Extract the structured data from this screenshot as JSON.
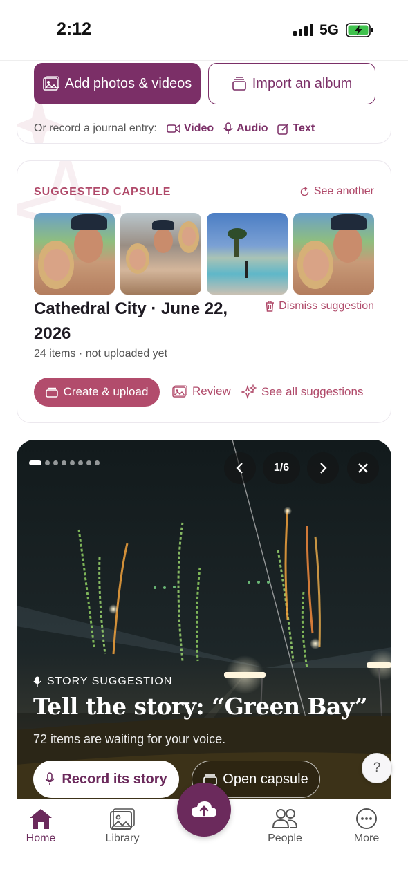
{
  "status_bar": {
    "time": "2:12",
    "network": "5G"
  },
  "top_card": {
    "add_label": "Add photos & videos",
    "import_label": "Import an album",
    "journal_prompt": "Or record a journal entry:",
    "journal_options": {
      "video": "Video",
      "audio": "Audio",
      "text": "Text"
    }
  },
  "suggested_capsule": {
    "section_label": "SUGGESTED CAPSULE",
    "see_another": "See another",
    "title": "Cathedral City · June 22, 2026",
    "dismiss": "Dismiss suggestion",
    "subtitle": "24 items · not uploaded yet",
    "create_label": "Create & upload",
    "review_label": "Review",
    "see_all_label": "See all suggestions"
  },
  "story": {
    "page_indicator": "1/6",
    "label": "STORY SUGGESTION",
    "title": "Tell the story: “Green Bay”",
    "subtitle": "72 items are waiting for your voice.",
    "record_label": "Record its story",
    "open_label": "Open capsule",
    "slide_count": 8,
    "active_slide": 1
  },
  "help": {
    "label": "?"
  },
  "nav": {
    "items": [
      {
        "label": "Home",
        "icon": "home-icon",
        "active": true
      },
      {
        "label": "Library",
        "icon": "library-icon",
        "active": false
      },
      {
        "label": "People",
        "icon": "people-icon",
        "active": false
      },
      {
        "label": "More",
        "icon": "more-icon",
        "active": false
      }
    ]
  },
  "colors": {
    "brand": "#7b2f67",
    "accent": "#b24c6c",
    "nav_active": "#6b2a5c"
  }
}
